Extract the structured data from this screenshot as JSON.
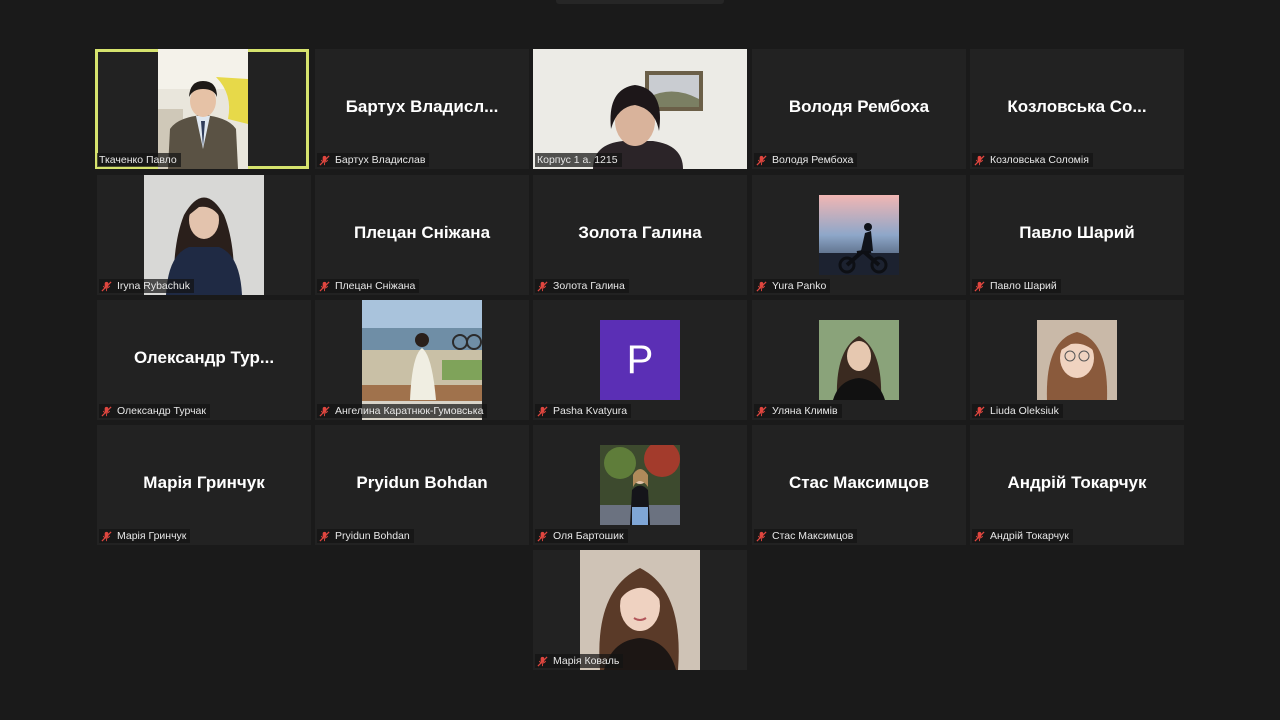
{
  "participants": [
    {
      "id": "pavlo",
      "label": "Ткаченко Павло",
      "muted": false,
      "active": true
    },
    {
      "id": "bartukh",
      "name": "Бартух  Владисл...",
      "label": "Бартух Владислав",
      "muted": true
    },
    {
      "id": "korpus",
      "label": "Корпус 1 а. 1215",
      "muted": false
    },
    {
      "id": "rembokha",
      "name": "Володя Рембоха",
      "label": "Володя Рембоха",
      "muted": true
    },
    {
      "id": "kozlovska",
      "name": "Козловська  Со...",
      "label": "Козловська Соломія",
      "muted": true
    },
    {
      "id": "rybachuk",
      "label": "Iryna Rybachuk",
      "muted": true
    },
    {
      "id": "pletsan",
      "name": "Плецан Сніжана",
      "label": "Плецан Сніжана",
      "muted": true
    },
    {
      "id": "zolota",
      "name": "Золота Галина",
      "label": "Золота Галина",
      "muted": true
    },
    {
      "id": "panko",
      "label": "Yura Panko",
      "muted": true
    },
    {
      "id": "sharyi",
      "name": "Павло Шарий",
      "label": "Павло Шарий",
      "muted": true
    },
    {
      "id": "turchak",
      "name": "Олександр  Тур...",
      "label": "Олександр Турчак",
      "muted": true
    },
    {
      "id": "karatniuk",
      "label": "Ангелина Каратнюк-Гумовська",
      "muted": true
    },
    {
      "id": "kvatyura",
      "avatar_letter": "P",
      "label": "Pasha Kvatyura",
      "muted": true
    },
    {
      "id": "klymiv",
      "label": "Уляна Климів",
      "muted": true
    },
    {
      "id": "oleksiuk",
      "label": "Liuda Oleksiuk",
      "muted": true
    },
    {
      "id": "hrynchuk",
      "name": "Марія Гринчук",
      "label": "Марія Гринчук",
      "muted": true
    },
    {
      "id": "pryidun",
      "name": "Pryidun Bohdan",
      "label": "Pryidun Bohdan",
      "muted": true
    },
    {
      "id": "bartoshyk",
      "label": "Оля Бартошик",
      "muted": true
    },
    {
      "id": "maksymtsov",
      "name": "Стас Максимцов",
      "label": "Стас Максимцов",
      "muted": true
    },
    {
      "id": "tokarchuk",
      "name": "Андрій Токарчук",
      "label": "Андрій Токарчук",
      "muted": true
    },
    {
      "id": "koval",
      "label": "Марія Коваль",
      "muted": true
    }
  ],
  "colors": {
    "background": "#1a1a1a",
    "tile": "#222222",
    "active_border": "#d6e36e",
    "mute_icon": "#e0463f",
    "avatar_purple": "#5b2fb5"
  },
  "icons": {
    "muted": "microphone-muted-icon"
  }
}
